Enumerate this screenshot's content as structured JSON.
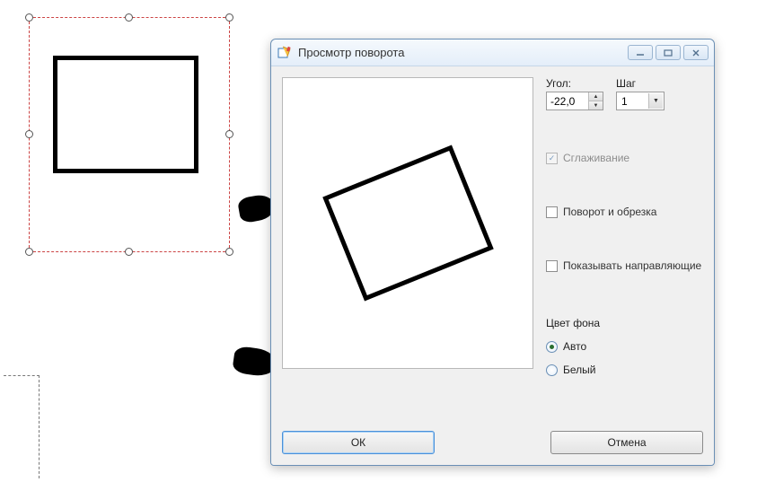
{
  "canvas": {
    "shape": "rectangle"
  },
  "dialog": {
    "title": "Просмотр поворота",
    "angle": {
      "label": "Угол:",
      "value": "-22,0"
    },
    "step": {
      "label": "Шаг",
      "value": "1"
    },
    "smoothing": {
      "label": "Сглаживание",
      "checked": true,
      "disabled": true
    },
    "rotate_crop": {
      "label": "Поворот и обрезка",
      "checked": false
    },
    "show_guides": {
      "label": "Показывать направляющие",
      "checked": false
    },
    "bg_color": {
      "label": "Цвет фона",
      "auto": "Авто",
      "white": "Белый",
      "selected": "auto"
    },
    "buttons": {
      "ok": "ОК",
      "cancel": "Отмена"
    }
  }
}
